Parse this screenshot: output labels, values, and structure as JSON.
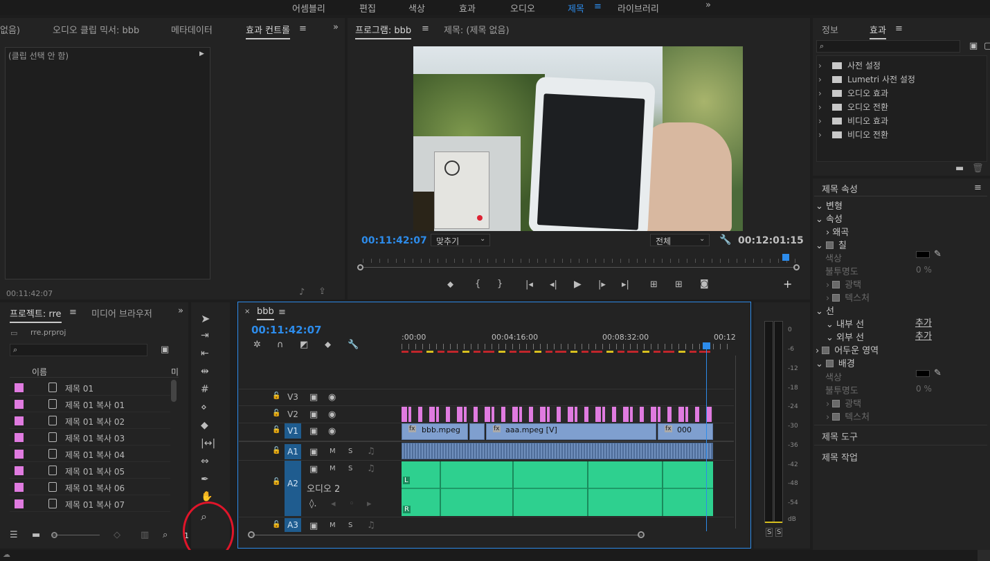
{
  "workspaces": [
    "어셈블리",
    "편집",
    "색상",
    "효과",
    "오디오",
    "제목",
    "라이브러리"
  ],
  "workspace_active": "제목",
  "overflow": "»",
  "source_panel": {
    "tabs": [
      "없음)",
      "오디오 클립 믹서: bbb",
      "메타데이터",
      "효과 컨트롤"
    ],
    "no_clip": "(클립 선택 안 함)",
    "timecode": "00:11:42:07"
  },
  "program_monitor": {
    "tabs": [
      "프로그램: bbb",
      "제목: (제목 없음)"
    ],
    "timecode": "00:11:42:07",
    "fit": "맞추기",
    "quality": "전체",
    "duration": "00:12:01:15"
  },
  "effects_panel": {
    "tabs": [
      "정보",
      "효과"
    ],
    "items": [
      "사전 설정",
      "Lumetri 사전 설정",
      "오디오 효과",
      "오디오 전환",
      "비디오 효과",
      "비디오 전환"
    ]
  },
  "title_properties": {
    "header": "제목 속성",
    "rows": [
      {
        "t": "변형",
        "lvl": 0
      },
      {
        "t": "속성",
        "lvl": 0
      },
      {
        "t": "왜곡",
        "lvl": 1
      },
      {
        "t": "칠",
        "lvl": 0
      },
      {
        "t": "색상",
        "lvl": 2
      },
      {
        "t": "불투명도",
        "lvl": 2
      },
      {
        "t": "광택",
        "lvl": 1
      },
      {
        "t": "텍스처",
        "lvl": 1
      },
      {
        "t": "선",
        "lvl": 0
      },
      {
        "t": "내부 선",
        "lvl": 1
      },
      {
        "t": "외부 선",
        "lvl": 1
      },
      {
        "t": "어두운 영역",
        "lvl": 0
      },
      {
        "t": "배경",
        "lvl": 0
      },
      {
        "t": "색상",
        "lvl": 2
      },
      {
        "t": "불투명도",
        "lvl": 2
      },
      {
        "t": "광택",
        "lvl": 1
      },
      {
        "t": "텍스처",
        "lvl": 1
      }
    ],
    "add_label": "추가",
    "opacity_value": "0 %",
    "tools": "제목 도구",
    "actions": "제목 작업"
  },
  "project_panel": {
    "tabs": [
      "프로젝트: rre",
      "미디어 브라우저"
    ],
    "file": "rre.prproj",
    "col_name": "이름",
    "col_more": "미",
    "items": [
      "제목 01",
      "제목 01 복사 01",
      "제목 01 복사 02",
      "제목 01 복사 03",
      "제목 01 복사 04",
      "제목 01 복사 05",
      "제목 01 복사 06",
      "제목 01 복사 07"
    ],
    "badge": "1"
  },
  "timeline": {
    "sequence": "bbb",
    "timecode": "00:11:42:07",
    "ruler": [
      ":00:00",
      "00:04:16:00",
      "00:08:32:00",
      "00:12"
    ],
    "tracks": [
      "V3",
      "V2",
      "V1",
      "A1",
      "A2",
      "A3"
    ],
    "a2_name": "오디오 2",
    "clips": [
      "bbb.mpeg",
      "aaa.mpeg [V]",
      "000"
    ],
    "channel_l": "L",
    "channel_r": "R",
    "m": "M",
    "s": "S"
  },
  "meter": {
    "scale": [
      "0",
      "-6",
      "-12",
      "-18",
      "-24",
      "-30",
      "-36",
      "-42",
      "-48",
      "-54",
      "dB"
    ],
    "solo": [
      "S",
      "S"
    ]
  },
  "colors": {
    "accent": "#2d8ceb",
    "clip_audio": "#2ed08f",
    "clip_video": "#7f9fcf",
    "title_clip": "#e07be0",
    "highlight_circle": "#e0152a"
  }
}
